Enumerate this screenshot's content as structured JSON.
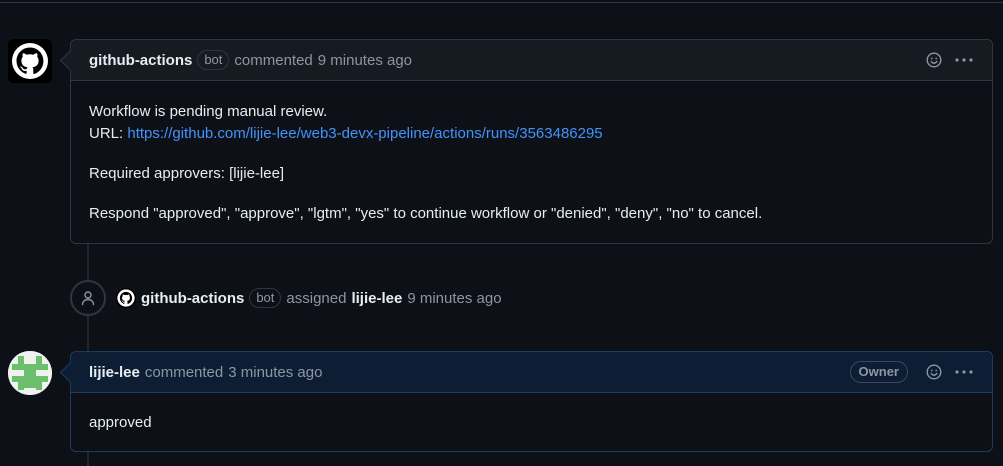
{
  "first_comment": {
    "author": "github-actions",
    "bot_label": "bot",
    "action": "commented",
    "time": "9 minutes ago",
    "line1": "Workflow is pending manual review.",
    "url_label": "URL:",
    "url": "https://github.com/lijie-lee/web3-devx-pipeline/actions/runs/3563486295",
    "approvers": "Required approvers: [lijie-lee]",
    "instructions": "Respond \"approved\", \"approve\", \"lgtm\", \"yes\" to continue workflow or \"denied\", \"deny\", \"no\" to cancel.",
    "icons": [
      "smiley-icon",
      "kebab-icon"
    ]
  },
  "assign_event": {
    "actor": "github-actions",
    "bot_label": "bot",
    "verb": "assigned",
    "target": "lijie-lee",
    "time": "9 minutes ago",
    "icon": "person-icon"
  },
  "second_comment": {
    "author": "lijie-lee",
    "action": "commented",
    "time": "3 minutes ago",
    "role_badge": "Owner",
    "body": "approved",
    "icons": [
      "smiley-icon",
      "kebab-icon"
    ]
  },
  "colors": {
    "background": "#0d1117",
    "link": "#4493f8",
    "muted": "#8d96a0",
    "border": "#30363d"
  }
}
